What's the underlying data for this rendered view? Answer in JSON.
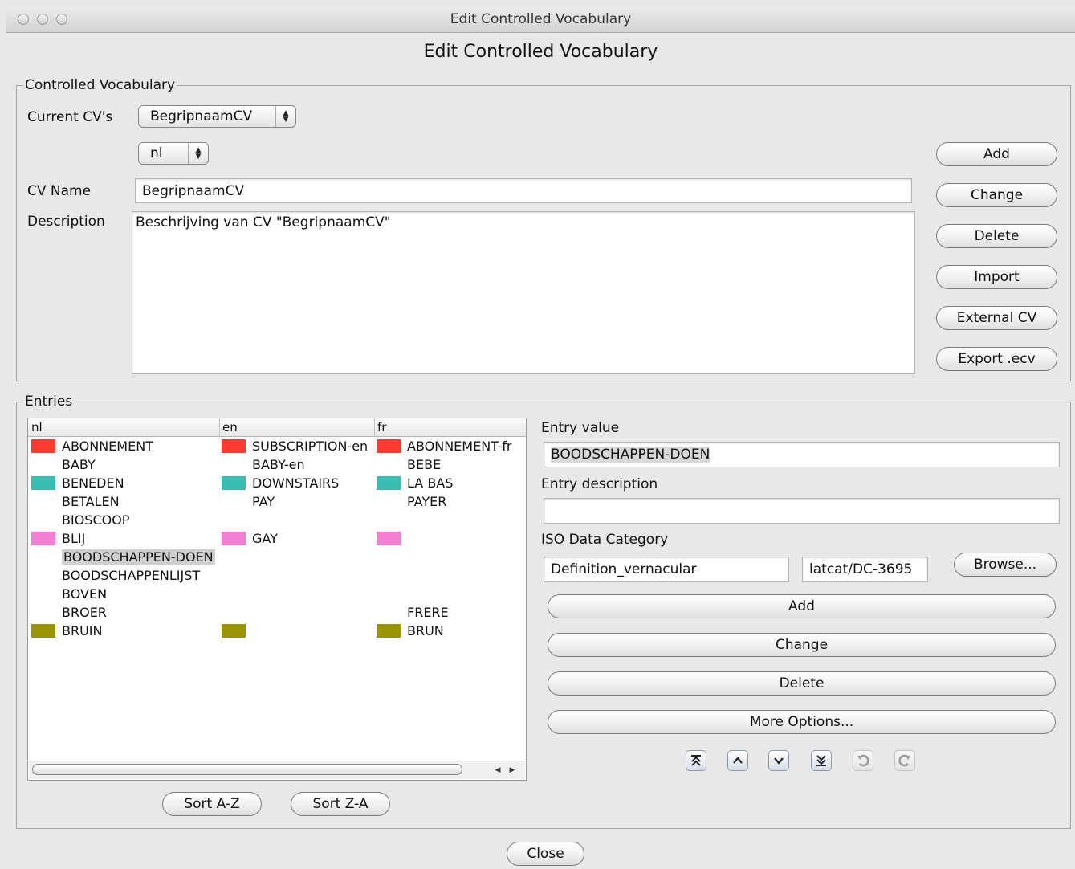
{
  "window": {
    "title": "Edit Controlled Vocabulary",
    "heading": "Edit Controlled Vocabulary"
  },
  "cv_section": {
    "legend": "Controlled Vocabulary",
    "current_label": "Current CV's",
    "current_value": "BegripnaamCV",
    "language_value": "nl",
    "name_label": "CV Name",
    "name_value": "BegripnaamCV",
    "description_label": "Description",
    "description_value": "Beschrijving van CV \"BegripnaamCV\"",
    "buttons": {
      "add": "Add",
      "change": "Change",
      "delete": "Delete",
      "import": "Import",
      "external": "External CV",
      "export": "Export .ecv"
    }
  },
  "entries_section": {
    "legend": "Entries",
    "columns": [
      "nl",
      "en",
      "fr"
    ],
    "rows": [
      {
        "nl": "ABONNEMENT",
        "en": "SUBSCRIPTION-en",
        "fr": "ABONNEMENT-fr",
        "color": "#ff3b2f",
        "selected": false
      },
      {
        "nl": "BABY",
        "en": "BABY-en",
        "fr": "BEBE",
        "color": null,
        "selected": false
      },
      {
        "nl": "BENEDEN",
        "en": "DOWNSTAIRS",
        "fr": "LA BAS",
        "color": "#38bdb4",
        "selected": false
      },
      {
        "nl": "BETALEN",
        "en": "PAY",
        "fr": "PAYER",
        "color": null,
        "selected": false
      },
      {
        "nl": "BIOSCOOP",
        "en": "",
        "fr": "",
        "color": null,
        "selected": false
      },
      {
        "nl": "BLIJ",
        "en": "GAY",
        "fr": "",
        "color": "#f47fd2",
        "selected": false
      },
      {
        "nl": "BOODSCHAPPEN-DOEN",
        "en": "",
        "fr": "",
        "color": null,
        "selected": true
      },
      {
        "nl": "BOODSCHAPPENLIJST",
        "en": "",
        "fr": "",
        "color": null,
        "selected": false
      },
      {
        "nl": "BOVEN",
        "en": "",
        "fr": "",
        "color": null,
        "selected": false
      },
      {
        "nl": "BROER",
        "en": "",
        "fr": "FRERE",
        "color": null,
        "selected": false
      },
      {
        "nl": "BRUIN",
        "en": "",
        "fr": "BRUN",
        "color": "#9a9500",
        "selected": false
      }
    ],
    "sort_az": "Sort A-Z",
    "sort_za": "Sort Z-A",
    "entry_value_label": "Entry value",
    "entry_value": "BOODSCHAPPEN-DOEN",
    "entry_description_label": "Entry description",
    "entry_description": "",
    "iso_label": "ISO Data Category",
    "iso_name": "Definition_vernacular",
    "iso_id": "latcat/DC-3695",
    "browse": "Browse...",
    "buttons": {
      "add": "Add",
      "change": "Change",
      "delete": "Delete",
      "more": "More Options..."
    },
    "nav_icons": [
      "move-top-icon",
      "move-up-icon",
      "move-down-icon",
      "move-bottom-icon",
      "undo-icon",
      "redo-icon"
    ]
  },
  "close": "Close"
}
